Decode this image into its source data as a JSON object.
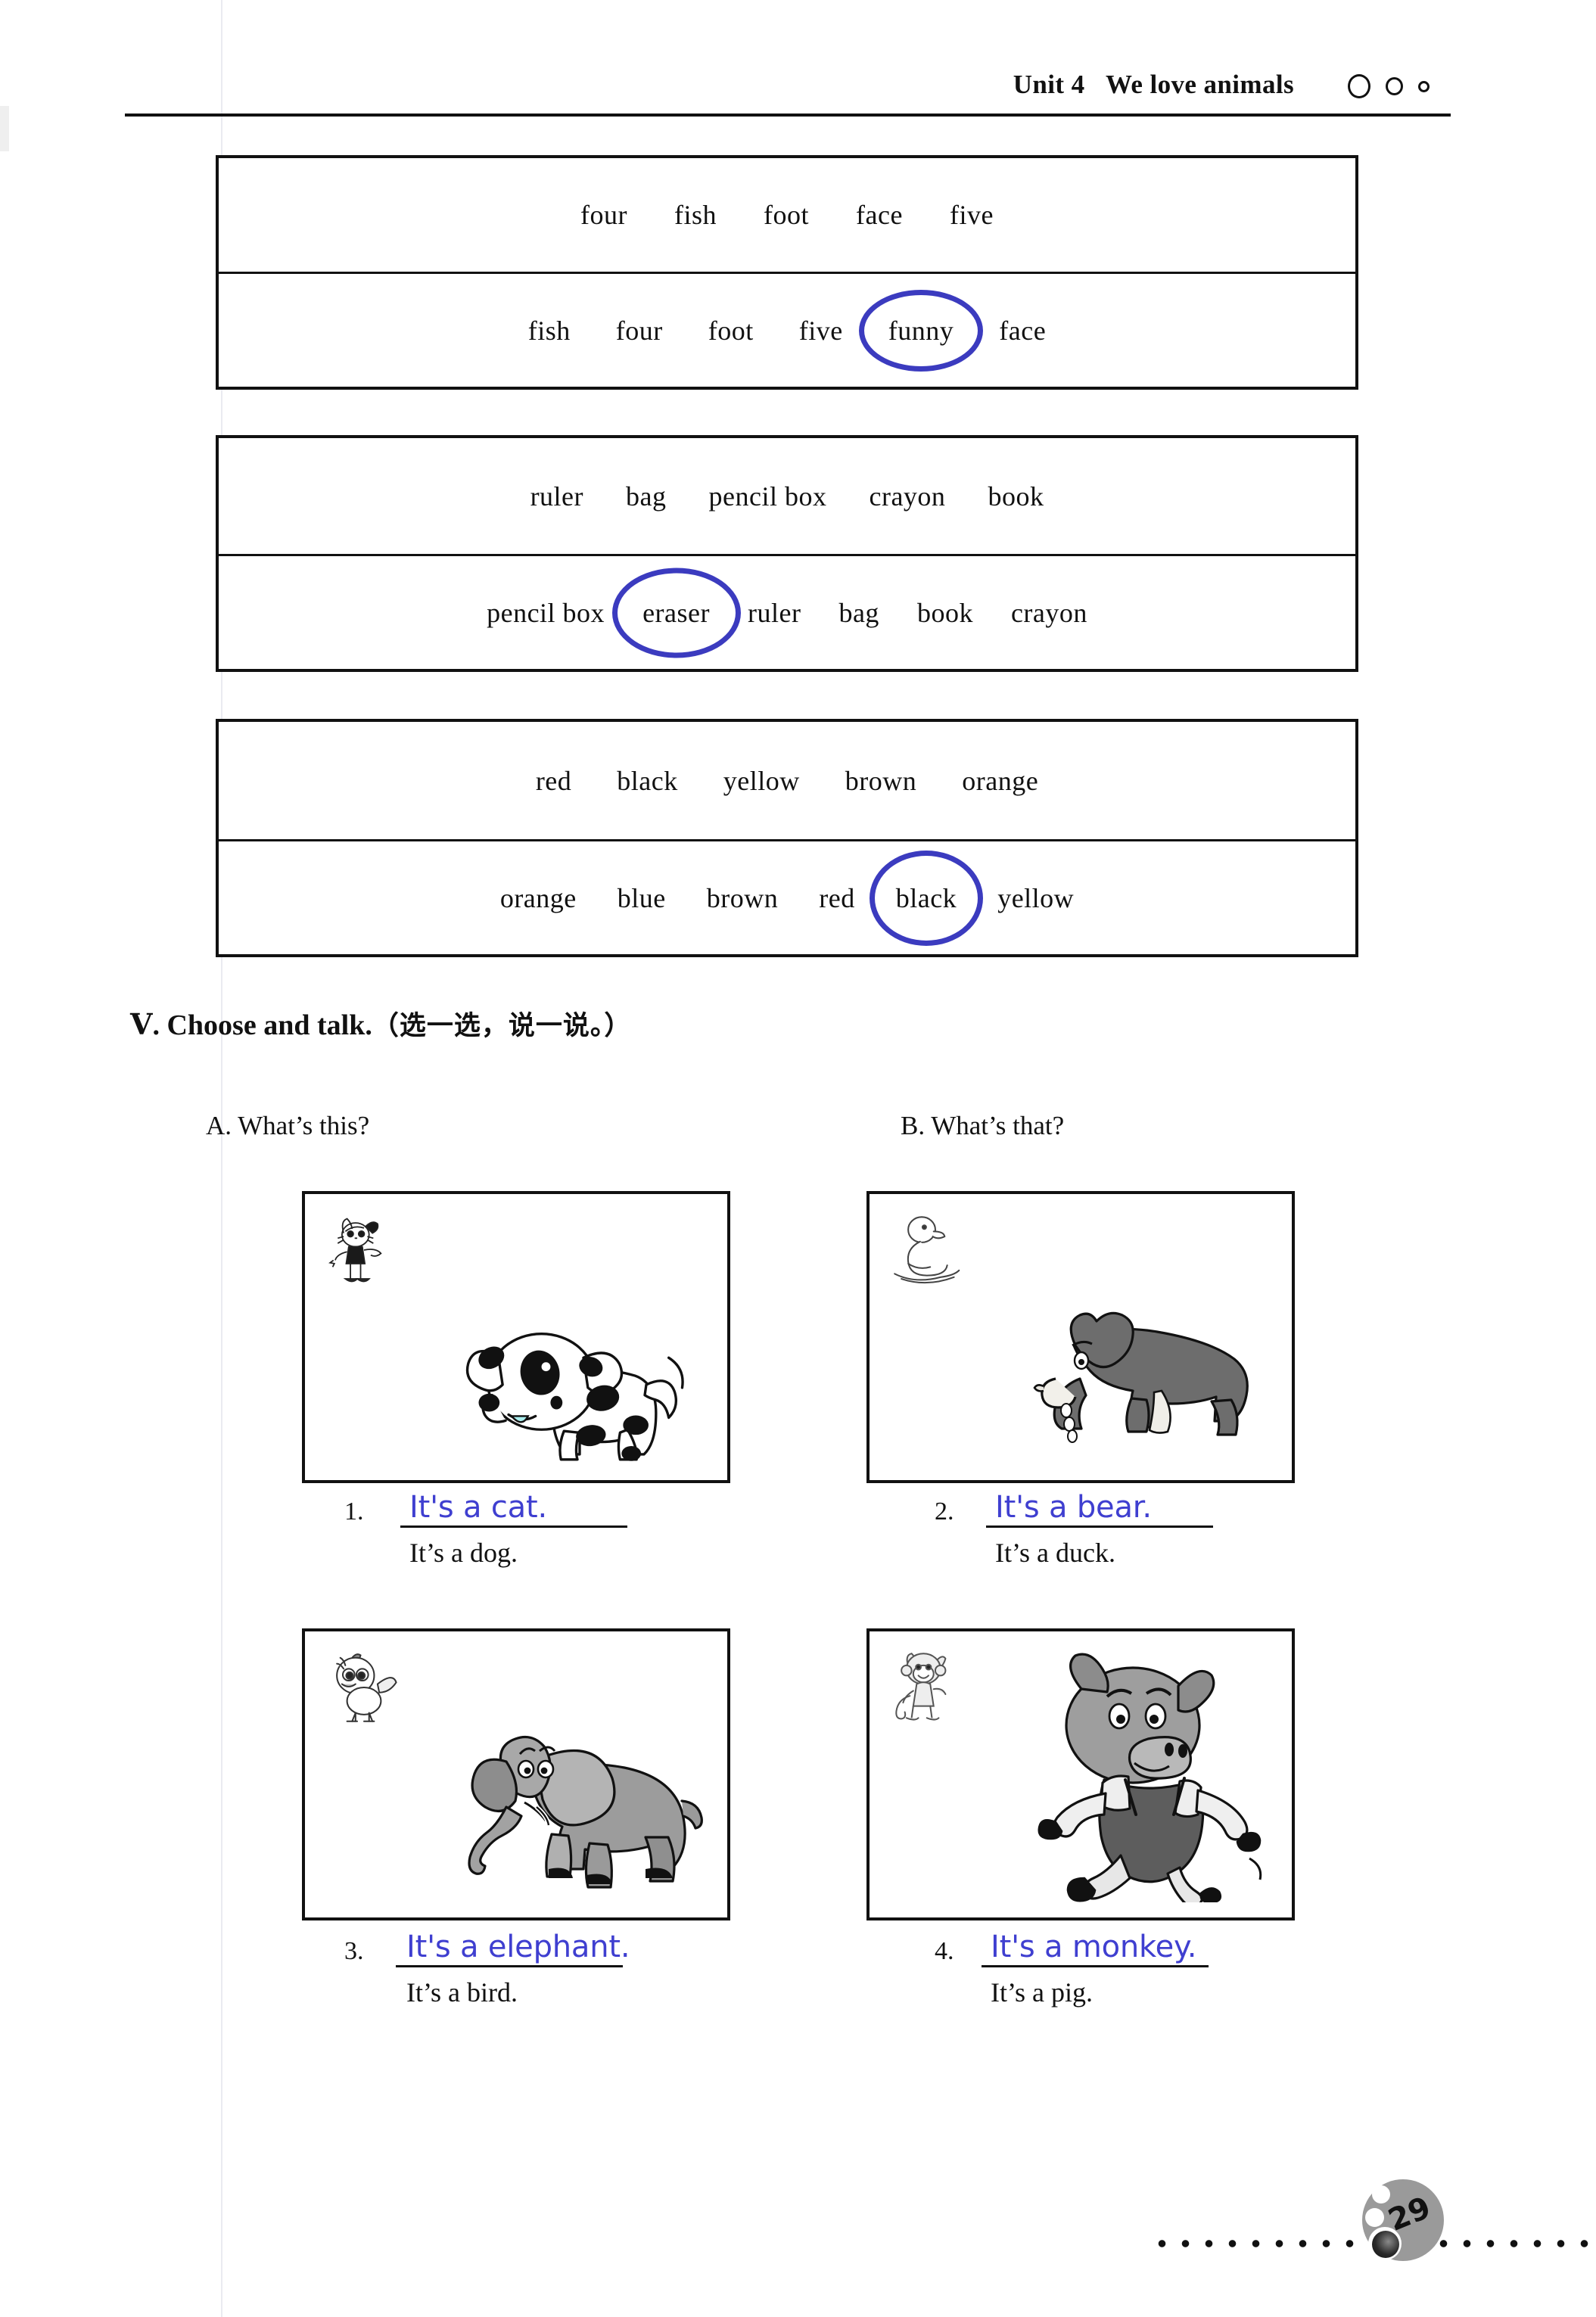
{
  "header": {
    "unit_label": "Unit 4",
    "unit_title": "We love animals",
    "dots": [
      "large-circle",
      "medium-circle",
      "small-circle"
    ]
  },
  "word_boxes": [
    {
      "name": "f-words",
      "row1": [
        "four",
        "fish",
        "foot",
        "face",
        "five"
      ],
      "row2": [
        "fish",
        "four",
        "foot",
        "five",
        "funny",
        "face"
      ],
      "circled_word": "funny",
      "circled_index": 4
    },
    {
      "name": "school-things",
      "row1": [
        "ruler",
        "bag",
        "pencil box",
        "crayon",
        "book"
      ],
      "row2": [
        "pencil box",
        "eraser",
        "ruler",
        "bag",
        "book",
        "crayon"
      ],
      "circled_word": "eraser",
      "circled_index": 1
    },
    {
      "name": "colours",
      "row1": [
        "red",
        "black",
        "yellow",
        "brown",
        "orange"
      ],
      "row2": [
        "orange",
        "blue",
        "brown",
        "red",
        "black",
        "yellow"
      ],
      "circled_word": "black",
      "circled_index": 4
    }
  ],
  "section": {
    "numeral": "Ⅴ",
    "dot": ".",
    "title": "Choose and talk.",
    "chinese": "（选一选，说一说。）"
  },
  "columns": {
    "a_prompt": "A. What’s this?",
    "b_prompt": "B. What’s that?"
  },
  "items": [
    {
      "number": "1.",
      "picture": "spotted-dog",
      "thumb": "cat-toy",
      "handwritten_answer": "It's a cat.",
      "printed_answer": "It’s a dog."
    },
    {
      "number": "2.",
      "picture": "bear",
      "thumb": "duck",
      "handwritten_answer": "It's a bear.",
      "printed_answer": "It’s a duck."
    },
    {
      "number": "3.",
      "picture": "elephant",
      "thumb": "bird",
      "handwritten_answer": "It's a elephant.",
      "printed_answer": "It’s a bird."
    },
    {
      "number": "4.",
      "picture": "pig",
      "thumb": "monkey",
      "handwritten_answer": "It's a monkey.",
      "printed_answer": "It’s a pig."
    }
  ],
  "footer": {
    "page_number": "29"
  },
  "colors": {
    "ink_blue": "#3b3bbf",
    "handwriting_blue": "#3f3fd0",
    "rule_black": "#111111",
    "badge_gray": "#9a9a9a"
  }
}
